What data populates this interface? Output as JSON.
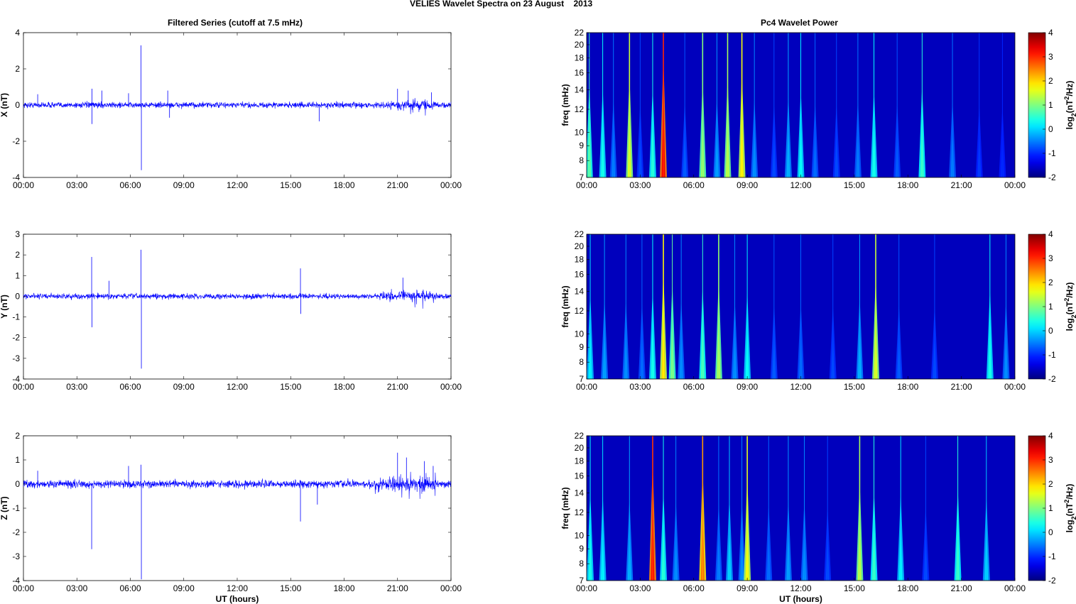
{
  "title": "VELIES Wavelet Spectra on 23 August    2013",
  "chart_data": [
    {
      "type": "line",
      "panel": "X",
      "title": "Filtered Series (cutoff at 7.5 mHz)",
      "xlabel": "",
      "ylabel": "X (nT)",
      "xlim": [
        0,
        24
      ],
      "ylim": [
        -4,
        4
      ],
      "yticks": [
        -4,
        -2,
        0,
        2,
        4
      ],
      "xtick_labels": [
        "00:00",
        "03:00",
        "06:00",
        "09:00",
        "12:00",
        "15:00",
        "18:00",
        "21:00",
        "00:00"
      ],
      "noise_amplitude": 0.15,
      "color": "#0000ff",
      "spikes": [
        [
          0.8,
          0.6
        ],
        [
          3.85,
          -1.05
        ],
        [
          3.85,
          0.9
        ],
        [
          4.4,
          0.8
        ],
        [
          5.9,
          0.65
        ],
        [
          6.6,
          3.3
        ],
        [
          6.62,
          -3.6
        ],
        [
          8.1,
          0.8
        ],
        [
          8.2,
          -0.7
        ],
        [
          16.6,
          -0.9
        ],
        [
          21.0,
          0.9
        ],
        [
          21.6,
          0.8
        ],
        [
          22.9,
          0.7
        ]
      ],
      "bursts": [
        [
          20.5,
          23.2,
          0.35
        ]
      ]
    },
    {
      "type": "line",
      "panel": "Y",
      "xlabel": "",
      "ylabel": "Y (nT)",
      "xlim": [
        0,
        24
      ],
      "ylim": [
        -4,
        3
      ],
      "yticks": [
        -4,
        -3,
        -2,
        -1,
        0,
        1,
        2,
        3
      ],
      "xtick_labels": [
        "00:00",
        "03:00",
        "06:00",
        "09:00",
        "12:00",
        "15:00",
        "18:00",
        "21:00",
        "00:00"
      ],
      "noise_amplitude": 0.12,
      "color": "#0000ff",
      "spikes": [
        [
          3.83,
          1.9
        ],
        [
          3.85,
          -1.5
        ],
        [
          4.8,
          0.75
        ],
        [
          6.6,
          2.25
        ],
        [
          6.62,
          -3.5
        ],
        [
          15.55,
          1.35
        ],
        [
          15.57,
          -0.85
        ],
        [
          21.3,
          0.9
        ]
      ],
      "bursts": [
        [
          20.0,
          23.2,
          0.35
        ]
      ]
    },
    {
      "type": "line",
      "panel": "Z",
      "xlabel": "UT (hours)",
      "ylabel": "Z (nT)",
      "xlim": [
        0,
        24
      ],
      "ylim": [
        -4,
        2
      ],
      "yticks": [
        -4,
        -3,
        -2,
        -1,
        0,
        1,
        2
      ],
      "xtick_labels": [
        "00:00",
        "03:00",
        "06:00",
        "09:00",
        "12:00",
        "15:00",
        "18:00",
        "21:00",
        "00:00"
      ],
      "noise_amplitude": 0.15,
      "color": "#0000ff",
      "spikes": [
        [
          0.8,
          0.55
        ],
        [
          3.83,
          -2.7
        ],
        [
          5.9,
          0.75
        ],
        [
          6.6,
          0.8
        ],
        [
          6.62,
          -3.95
        ],
        [
          15.55,
          -1.55
        ],
        [
          16.5,
          -0.85
        ],
        [
          21.0,
          1.3
        ],
        [
          21.5,
          1.1
        ],
        [
          22.5,
          0.95
        ],
        [
          23.0,
          0.75
        ]
      ],
      "bursts": [
        [
          19.5,
          23.3,
          0.5
        ]
      ]
    },
    {
      "type": "heatmap",
      "panel": "X",
      "title": "Pc4 Wavelet Power",
      "xlabel": "",
      "ylabel": "freq (mHz)",
      "xlim": [
        0,
        24
      ],
      "ylim": [
        7,
        22
      ],
      "yscale": "log",
      "yticks": [
        7,
        8,
        9,
        10,
        12,
        14,
        16,
        18,
        20,
        22
      ],
      "xtick_labels": [
        "00:00",
        "03:00",
        "06:00",
        "09:00",
        "12:00",
        "15:00",
        "18:00",
        "21:00",
        "00:00"
      ],
      "colorbar": {
        "label": "log2(nT²/Hz)",
        "label_base": "log",
        "label_sub": "2",
        "label_mid": "(nT",
        "label_sup": "2",
        "label_end": "/Hz)",
        "range": [
          -2,
          4
        ],
        "ticks": [
          -2,
          -1,
          0,
          1,
          2,
          3,
          4
        ]
      },
      "streaks": [
        [
          0.15,
          0.8
        ],
        [
          0.9,
          0.4
        ],
        [
          1.5,
          -0.5
        ],
        [
          2.4,
          1.6
        ],
        [
          3.0,
          -0.8
        ],
        [
          3.7,
          0.5
        ],
        [
          4.3,
          3.3
        ],
        [
          5.5,
          -0.7
        ],
        [
          6.5,
          1.2
        ],
        [
          7.3,
          -0.3
        ],
        [
          7.9,
          1.4
        ],
        [
          8.7,
          1.9
        ],
        [
          9.4,
          -0.4
        ],
        [
          10.5,
          -0.8
        ],
        [
          11.3,
          -0.2
        ],
        [
          12.0,
          0.3
        ],
        [
          12.8,
          -0.6
        ],
        [
          14.0,
          -0.8
        ],
        [
          15.2,
          -0.5
        ],
        [
          16.1,
          0.4
        ],
        [
          17.4,
          -0.7
        ],
        [
          18.8,
          0.6
        ],
        [
          20.5,
          -0.5
        ],
        [
          22.0,
          -0.9
        ],
        [
          23.3,
          -1.0
        ]
      ]
    },
    {
      "type": "heatmap",
      "panel": "Y",
      "ylabel": "freq (mHz)",
      "xlim": [
        0,
        24
      ],
      "ylim": [
        7,
        22
      ],
      "yscale": "log",
      "yticks": [
        7,
        8,
        9,
        10,
        12,
        14,
        16,
        18,
        20,
        22
      ],
      "xtick_labels": [
        "00:00",
        "03:00",
        "06:00",
        "09:00",
        "12:00",
        "15:00",
        "18:00",
        "21:00",
        "00:00"
      ],
      "colorbar": {
        "label": "log2(nT²/Hz)",
        "label_base": "log",
        "label_sub": "2",
        "label_mid": "(nT",
        "label_sup": "2",
        "label_end": "/Hz)",
        "range": [
          -2,
          4
        ],
        "ticks": [
          -2,
          -1,
          0,
          1,
          2,
          3,
          4
        ]
      },
      "streaks": [
        [
          0.2,
          0.2
        ],
        [
          1.0,
          -0.3
        ],
        [
          2.2,
          -0.4
        ],
        [
          3.1,
          -0.6
        ],
        [
          3.7,
          0.4
        ],
        [
          4.3,
          2.0
        ],
        [
          4.8,
          1.0
        ],
        [
          5.3,
          -0.4
        ],
        [
          6.5,
          0.7
        ],
        [
          7.4,
          1.3
        ],
        [
          8.3,
          -0.4
        ],
        [
          9.0,
          0.3
        ],
        [
          10.5,
          -0.7
        ],
        [
          12.0,
          -0.6
        ],
        [
          13.8,
          -0.8
        ],
        [
          15.3,
          -0.2
        ],
        [
          16.2,
          1.6
        ],
        [
          17.5,
          -0.7
        ],
        [
          19.5,
          -0.8
        ],
        [
          22.6,
          0.4
        ],
        [
          23.5,
          -0.4
        ]
      ]
    },
    {
      "type": "heatmap",
      "panel": "Z",
      "xlabel": "UT (hours)",
      "ylabel": "freq (mHz)",
      "xlim": [
        0,
        24
      ],
      "ylim": [
        7,
        22
      ],
      "yscale": "log",
      "yticks": [
        7,
        8,
        9,
        10,
        12,
        14,
        16,
        18,
        20,
        22
      ],
      "xtick_labels": [
        "00:00",
        "03:00",
        "06:00",
        "09:00",
        "12:00",
        "15:00",
        "18:00",
        "21:00",
        "00:00"
      ],
      "colorbar": {
        "label": "log2(nT²/Hz)",
        "label_base": "log",
        "label_sub": "2",
        "label_mid": "(nT",
        "label_sup": "2",
        "label_end": "/Hz)",
        "range": [
          -2,
          4
        ],
        "ticks": [
          -2,
          -1,
          0,
          1,
          2,
          3,
          4
        ]
      },
      "streaks": [
        [
          0.2,
          0.4
        ],
        [
          0.9,
          0.2
        ],
        [
          2.4,
          -0.2
        ],
        [
          3.7,
          3.2
        ],
        [
          4.3,
          0.5
        ],
        [
          5.0,
          -0.4
        ],
        [
          6.5,
          2.6
        ],
        [
          7.4,
          -0.5
        ],
        [
          8.0,
          0.0
        ],
        [
          8.7,
          -0.4
        ],
        [
          9.0,
          1.8
        ],
        [
          10.2,
          -0.6
        ],
        [
          11.3,
          -0.3
        ],
        [
          12.2,
          -0.4
        ],
        [
          13.5,
          -0.8
        ],
        [
          15.3,
          1.4
        ],
        [
          16.1,
          0.6
        ],
        [
          17.6,
          0.2
        ],
        [
          19.0,
          -0.8
        ],
        [
          20.8,
          0.6
        ],
        [
          22.4,
          0.0
        ]
      ]
    }
  ]
}
